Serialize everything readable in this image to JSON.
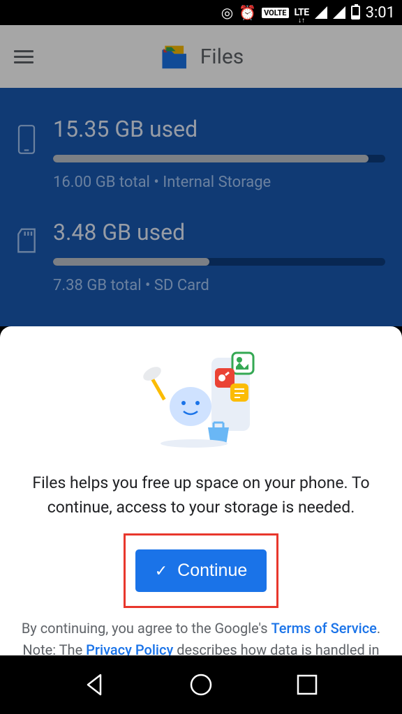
{
  "status": {
    "volte": "VOLTE",
    "lte": "LTE",
    "time": "3:01"
  },
  "header": {
    "app_name": "Files"
  },
  "storage": {
    "internal": {
      "used_label": "15.35 GB used",
      "detail": "16.00 GB total • Internal Storage",
      "percent": 95
    },
    "sdcard": {
      "used_label": "3.48 GB used",
      "detail": "7.38 GB total • SD Card",
      "percent": 47
    }
  },
  "sheet": {
    "message": "Files helps you free up space on your phone. To continue, access to your storage is needed.",
    "continue_label": "Continue",
    "legal_prefix": "By continuing, you agree to the Google's ",
    "tos": "Terms of Service",
    "legal_mid": ". Note: The ",
    "privacy": "Privacy Policy",
    "legal_suffix": " describes how data is handled in this service."
  }
}
